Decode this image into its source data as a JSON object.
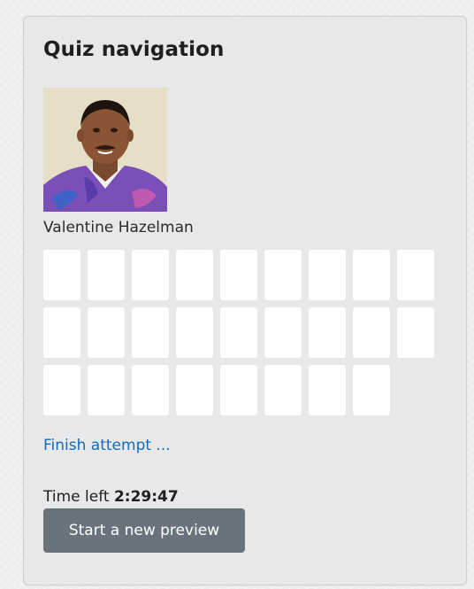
{
  "panel": {
    "title": "Quiz navigation"
  },
  "user": {
    "name": "Valentine Hazelman",
    "avatar_icon": "user-photo"
  },
  "questions": {
    "count": 26,
    "columns": 9,
    "button_color": "#ffffff"
  },
  "actions": {
    "finish_label": "Finish attempt ...",
    "preview_label": "Start a new preview"
  },
  "timer": {
    "label": "Time left ",
    "value": "2:29:47"
  },
  "colors": {
    "link": "#0f6cbf",
    "button_bg": "#6a737b",
    "panel_bg": "#e8e8e8"
  }
}
